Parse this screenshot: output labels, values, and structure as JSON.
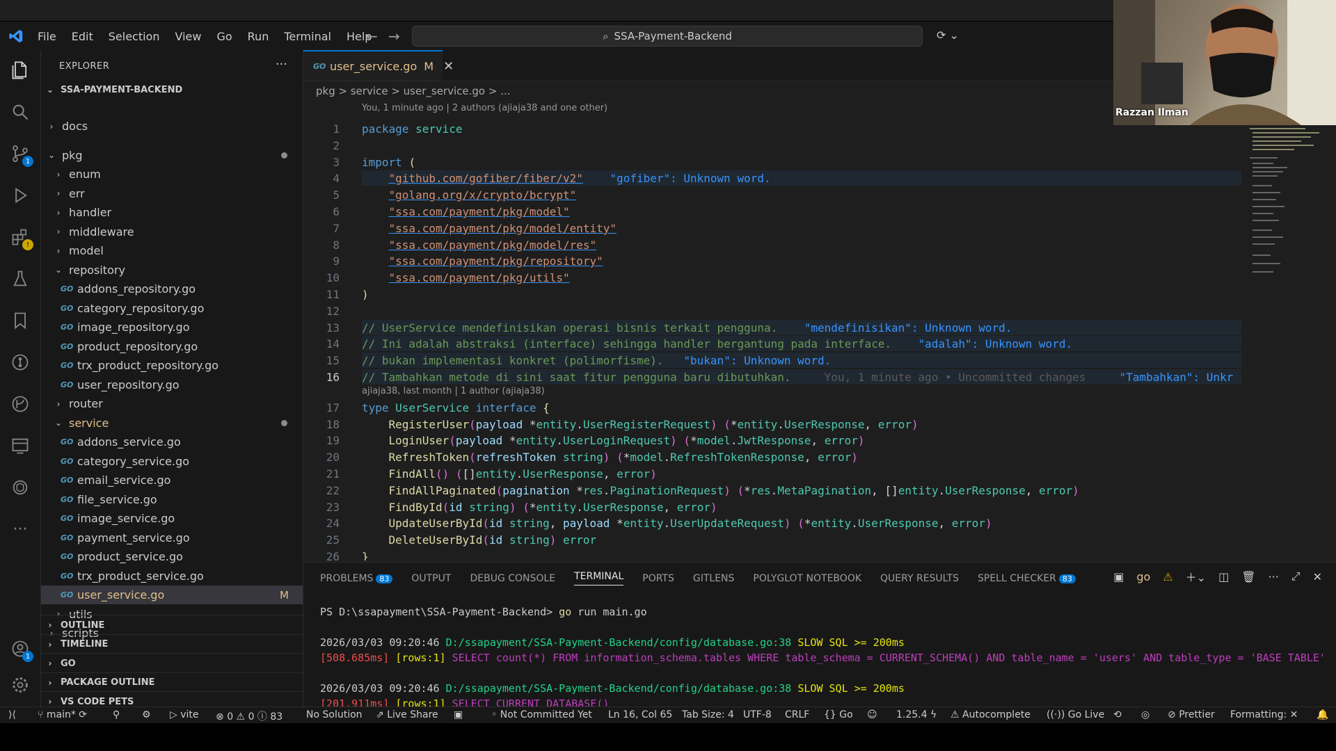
{
  "title_bar": {
    "menus": [
      "File",
      "Edit",
      "Selection",
      "View",
      "Go",
      "Run",
      "Terminal",
      "Help"
    ],
    "search": "SSA-Payment-Backend"
  },
  "activity_badges": {
    "scm": "1",
    "accounts": "1"
  },
  "explorer": {
    "title": "EXPLORER",
    "root": "SSA-PAYMENT-BACKEND",
    "items": [
      {
        "label": "docs",
        "kind": "folder",
        "depth": 1,
        "open": false
      },
      {
        "label": "pkg",
        "kind": "folder",
        "depth": 1,
        "open": true,
        "dot": true
      },
      {
        "label": "enum",
        "kind": "folder",
        "depth": 2,
        "open": false
      },
      {
        "label": "err",
        "kind": "folder",
        "depth": 2,
        "open": false
      },
      {
        "label": "handler",
        "kind": "folder",
        "depth": 2,
        "open": false
      },
      {
        "label": "middleware",
        "kind": "folder",
        "depth": 2,
        "open": false
      },
      {
        "label": "model",
        "kind": "folder",
        "depth": 2,
        "open": false
      },
      {
        "label": "repository",
        "kind": "folder",
        "depth": 2,
        "open": true
      },
      {
        "label": "addons_repository.go",
        "kind": "go",
        "depth": 3
      },
      {
        "label": "category_repository.go",
        "kind": "go",
        "depth": 3
      },
      {
        "label": "image_repository.go",
        "kind": "go",
        "depth": 3
      },
      {
        "label": "product_repository.go",
        "kind": "go",
        "depth": 3
      },
      {
        "label": "trx_product_repository.go",
        "kind": "go",
        "depth": 3
      },
      {
        "label": "user_repository.go",
        "kind": "go",
        "depth": 3
      },
      {
        "label": "router",
        "kind": "folder",
        "depth": 2,
        "open": false
      },
      {
        "label": "service",
        "kind": "folder",
        "depth": 2,
        "open": true,
        "dot": true,
        "mod": true
      },
      {
        "label": "addons_service.go",
        "kind": "go",
        "depth": 3
      },
      {
        "label": "category_service.go",
        "kind": "go",
        "depth": 3
      },
      {
        "label": "email_service.go",
        "kind": "go",
        "depth": 3
      },
      {
        "label": "file_service.go",
        "kind": "go",
        "depth": 3
      },
      {
        "label": "image_service.go",
        "kind": "go",
        "depth": 3
      },
      {
        "label": "payment_service.go",
        "kind": "go",
        "depth": 3
      },
      {
        "label": "product_service.go",
        "kind": "go",
        "depth": 3
      },
      {
        "label": "trx_product_service.go",
        "kind": "go",
        "depth": 3
      },
      {
        "label": "user_service.go",
        "kind": "go",
        "depth": 3,
        "selected": true,
        "mark": "M",
        "mod": true
      },
      {
        "label": "utils",
        "kind": "folder",
        "depth": 2,
        "open": false
      },
      {
        "label": "scripts",
        "kind": "folder",
        "depth": 1,
        "open": false
      }
    ],
    "sections": [
      "OUTLINE",
      "TIMELINE",
      "GO",
      "PACKAGE OUTLINE",
      "VS CODE PETS"
    ]
  },
  "editor": {
    "tab": {
      "label": "user_service.go",
      "mark": "M"
    },
    "breadcrumb": "pkg > service > user_service.go > ...",
    "blame_top": "You, 1 minute ago | 2 authors (ajiaja38 and one other)",
    "blame_mid": "ajiaja38, last month | 1 author (ajiaja38)",
    "current_line": 16,
    "lines": [
      {
        "n": 1,
        "html": "<span class='kw'>package</span> <span class='ty'>service</span>"
      },
      {
        "n": 2,
        "html": ""
      },
      {
        "n": 3,
        "html": "<span class='kw'>import</span> <span class='fn'>(</span>"
      },
      {
        "n": 4,
        "html": "    <span class='str'>\"github.com/gofiber/fiber/v2\"</span>    <span class='err'>\"gofiber\": Unknown word.</span>",
        "hl": true
      },
      {
        "n": 5,
        "html": "    <span class='str'>\"golang.org/x/crypto/bcrypt\"</span>"
      },
      {
        "n": 6,
        "html": "    <span class='str'>\"ssa.com/payment/pkg/model\"</span>"
      },
      {
        "n": 7,
        "html": "    <span class='str'>\"ssa.com/payment/pkg/model/entity\"</span>"
      },
      {
        "n": 8,
        "html": "    <span class='str'>\"ssa.com/payment/pkg/model/res\"</span>"
      },
      {
        "n": 9,
        "html": "    <span class='str'>\"ssa.com/payment/pkg/repository\"</span>"
      },
      {
        "n": 10,
        "html": "    <span class='str'>\"ssa.com/payment/pkg/utils\"</span>"
      },
      {
        "n": 11,
        "html": "<span class='fn'>)</span>"
      },
      {
        "n": 12,
        "html": ""
      },
      {
        "n": 13,
        "html": "<span class='cm'>// UserService mendefinisikan operasi bisnis terkait pengguna.</span>    <span class='err'>\"mendefinisikan\": Unknown word.</span>",
        "hl": true
      },
      {
        "n": 14,
        "html": "<span class='cm'>// Ini adalah abstraksi (interface) sehingga handler bergantung pada interface.</span>    <span class='err'>\"adalah\": Unknown word.</span>",
        "hl": true
      },
      {
        "n": 15,
        "html": "<span class='cm'>// bukan implementasi konkret (polimorfisme).</span>   <span class='err'>\"bukan\": Unknown word.</span>",
        "hl": true
      },
      {
        "n": 16,
        "html": "<span class='cm'>// Tambahkan metode di sini saat fitur pengguna baru dibutuhkan.</span>     <span class='ghost'>You, 1 minute ago • Uncommitted changes</span>     <span class='err'>\"Tambahkan\": Unkr</span>",
        "hl": true
      },
      {
        "n": 17,
        "html": "<span class='kw'>type</span> <span class='ty'>UserService</span> <span class='kw'>interface</span> <span class='fn'>{</span>"
      },
      {
        "n": 18,
        "html": "    <span class='fn'>RegisterUser</span><span class='br'>(</span><span class='var'>payload</span> *<span class='ty'>entity</span>.<span class='ty'>UserRegisterRequest</span><span class='br'>)</span> <span class='br'>(</span>*<span class='ty'>entity</span>.<span class='ty'>UserResponse</span>, <span class='ty'>error</span><span class='br'>)</span>"
      },
      {
        "n": 19,
        "html": "    <span class='fn'>LoginUser</span><span class='br'>(</span><span class='var'>payload</span> *<span class='ty'>entity</span>.<span class='ty'>UserLoginRequest</span><span class='br'>)</span> <span class='br'>(</span>*<span class='ty'>model</span>.<span class='ty'>JwtResponse</span>, <span class='ty'>error</span><span class='br'>)</span>"
      },
      {
        "n": 20,
        "html": "    <span class='fn'>RefreshToken</span><span class='br'>(</span><span class='var'>refreshToken</span> <span class='ty'>string</span><span class='br'>)</span> <span class='br'>(</span>*<span class='ty'>model</span>.<span class='ty'>RefreshTokenResponse</span>, <span class='ty'>error</span><span class='br'>)</span>"
      },
      {
        "n": 21,
        "html": "    <span class='fn'>FindAll</span><span class='br'>()</span> <span class='br'>(</span>[]<span class='ty'>entity</span>.<span class='ty'>UserResponse</span>, <span class='ty'>error</span><span class='br'>)</span>"
      },
      {
        "n": 22,
        "html": "    <span class='fn'>FindAllPaginated</span><span class='br'>(</span><span class='var'>pagination</span> *<span class='ty'>res</span>.<span class='ty'>PaginationRequest</span><span class='br'>)</span> <span class='br'>(</span>*<span class='ty'>res</span>.<span class='ty'>MetaPagination</span>, []<span class='ty'>entity</span>.<span class='ty'>UserResponse</span>, <span class='ty'>error</span><span class='br'>)</span>"
      },
      {
        "n": 23,
        "html": "    <span class='fn'>FindById</span><span class='br'>(</span><span class='var'>id</span> <span class='ty'>string</span><span class='br'>)</span> <span class='br'>(</span>*<span class='ty'>entity</span>.<span class='ty'>UserResponse</span>, <span class='ty'>error</span><span class='br'>)</span>"
      },
      {
        "n": 24,
        "html": "    <span class='fn'>UpdateUserById</span><span class='br'>(</span><span class='var'>id</span> <span class='ty'>string</span>, <span class='var'>payload</span> *<span class='ty'>entity</span>.<span class='ty'>UserUpdateRequest</span><span class='br'>)</span> <span class='br'>(</span>*<span class='ty'>entity</span>.<span class='ty'>UserResponse</span>, <span class='ty'>error</span><span class='br'>)</span>"
      },
      {
        "n": 25,
        "html": "    <span class='fn'>DeleteUserById</span><span class='br'>(</span><span class='var'>id</span> <span class='ty'>string</span><span class='br'>)</span> <span class='ty'>error</span>"
      },
      {
        "n": 26,
        "html": "<span class='fn'>}</span>"
      }
    ]
  },
  "panel": {
    "tabs": [
      {
        "label": "PROBLEMS",
        "badge": "83"
      },
      {
        "label": "OUTPUT"
      },
      {
        "label": "DEBUG CONSOLE"
      },
      {
        "label": "TERMINAL",
        "active": true
      },
      {
        "label": "PORTS"
      },
      {
        "label": "GITLENS"
      },
      {
        "label": "POLYGLOT NOTEBOOK"
      },
      {
        "label": "QUERY RESULTS"
      },
      {
        "label": "SPELL CHECKER",
        "badge": "83"
      }
    ],
    "terminal_name": "go",
    "terminal_lines": [
      {
        "html": "PS D:\\ssapayment\\SSA-Payment-Backend&gt; <span style='color:#dcdcaa'>go</span> run main.go"
      },
      {
        "html": ""
      },
      {
        "html": "2026/03/03 09:20:46 <span class='grn'>D:/ssapayment/SSA-Payment-Backend/config/database.go:38</span> <span class='yel'>SLOW SQL &gt;= 200ms</span>"
      },
      {
        "html": "<span class='red'>[508.685ms]</span> <span class='yel'>[rows:1]</span> <span class='pur'>SELECT count(*) FROM information_schema.tables WHERE table_schema = CURRENT_SCHEMA() AND table_name = 'users' AND table_type = 'BASE TABLE'</span>"
      },
      {
        "html": ""
      },
      {
        "html": "2026/03/03 09:20:46 <span class='grn'>D:/ssapayment/SSA-Payment-Backend/config/database.go:38</span> <span class='yel'>SLOW SQL &gt;= 200ms</span>"
      },
      {
        "html": "<span class='red'>[201.911ms]</span> <span class='yel'>[rows:1]</span> <span class='pur'>SELECT CURRENT_DATABASE()</span>"
      }
    ]
  },
  "status": {
    "branch": "main*",
    "vite": "vite",
    "problems": "0",
    "warnings": "0",
    "infos": "83",
    "solution": "No Solution",
    "liveshare": "Live Share",
    "commit": "Not Committed Yet",
    "position": "Ln 16, Col 65",
    "tabsize": "Tab Size: 4",
    "encoding": "UTF-8",
    "eol": "CRLF",
    "lang": "Go",
    "version": "1.25.4",
    "autocomplete": "Autocomplete",
    "golive": "Go Live",
    "prettier": "Prettier",
    "formatting": "Formatting:"
  },
  "webcam": {
    "name": "Razzan Ilman"
  },
  "colors": {
    "accent": "#0078d4",
    "modified": "#e2c08d",
    "editor_bg": "#1e1e1e",
    "sidebar_bg": "#181818"
  }
}
